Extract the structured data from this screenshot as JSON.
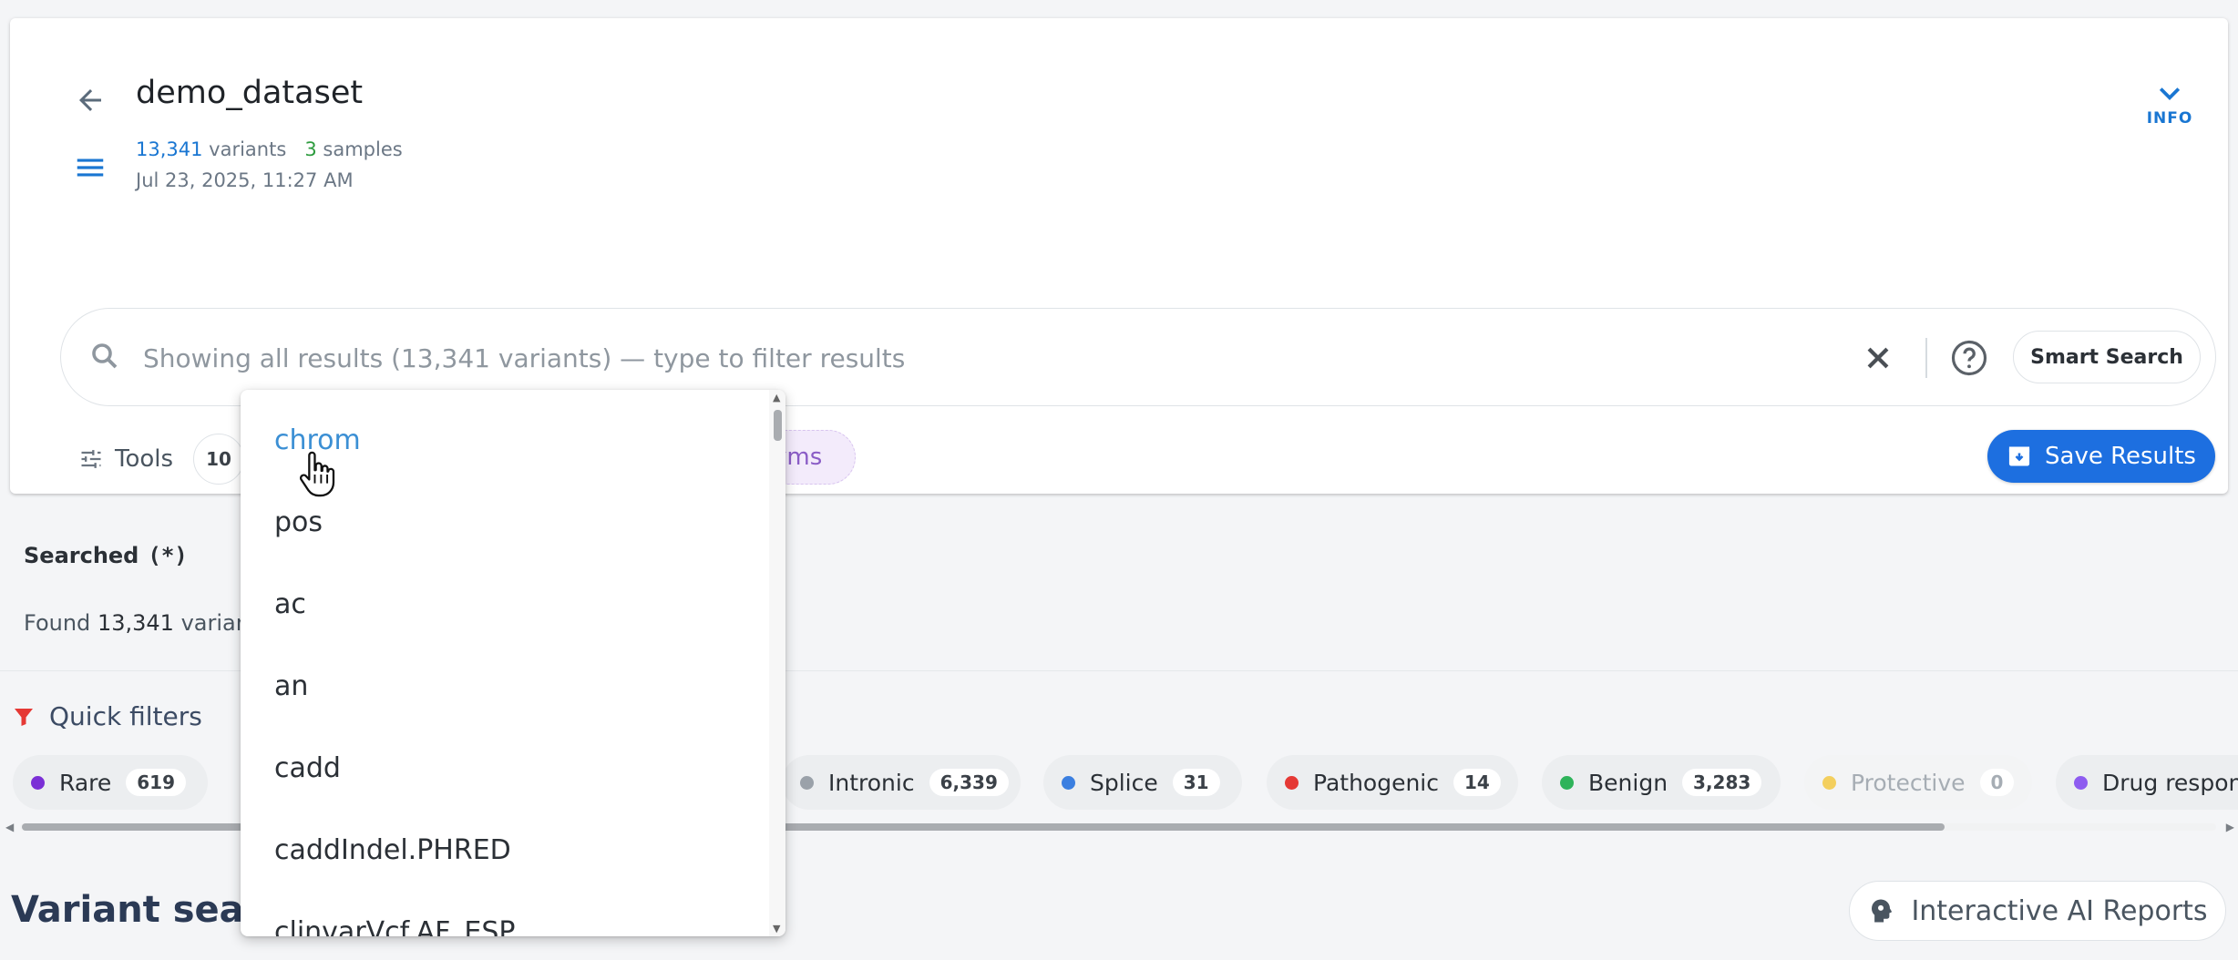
{
  "header": {
    "title": "demo_dataset",
    "variants_count": "13,341",
    "variants_label": "variants",
    "samples_count": "3",
    "samples_label": "samples",
    "date": "Jul 23, 2025, 11:27 AM",
    "info_label": "INFO"
  },
  "search": {
    "placeholder": "Showing all results (13,341 variants) — type to filter results",
    "value": "",
    "smart_search_label": "Smart Search"
  },
  "toolbar": {
    "tools_label": "Tools",
    "tools_count": "10",
    "synonyms_label_partial": "yms",
    "save_label": "Save Results"
  },
  "results": {
    "searched_label": "Searched",
    "searched_query": "(*)",
    "found_prefix": "Found",
    "found_count": "13,341",
    "found_suffix": "variant"
  },
  "quick_filters": {
    "title": "Quick filters",
    "chips": [
      {
        "label": "Rare",
        "count": "619",
        "color": "#7b2fd6",
        "disabled": false
      },
      {
        "label": "Intronic",
        "count": "6,339",
        "color": "#9aa1a9",
        "disabled": false
      },
      {
        "label": "Splice",
        "count": "31",
        "color": "#3b7fe0",
        "disabled": false
      },
      {
        "label": "Pathogenic",
        "count": "14",
        "color": "#e53935",
        "disabled": false
      },
      {
        "label": "Benign",
        "count": "3,283",
        "color": "#2eb35a",
        "disabled": false
      },
      {
        "label": "Protective",
        "count": "0",
        "color": "#f3cf5e",
        "disabled": true
      },
      {
        "label": "Drug respons",
        "count": "",
        "color": "#8e5cf0",
        "disabled": false
      }
    ]
  },
  "section": {
    "title": "Variant searc",
    "ai_reports_label": "Interactive AI Reports"
  },
  "dropdown": {
    "items": [
      "chrom",
      "pos",
      "ac",
      "an",
      "cadd",
      "caddIndel.PHRED",
      "clinvarVcf.AF_ESP"
    ],
    "active_index": 0
  },
  "colors": {
    "accent": "#1976d2",
    "save_button": "#1d6fe0",
    "synonyms_chip_bg": "#f3ebfb",
    "synonyms_chip_text": "#8a5cc6",
    "quick_filter_icon": "#e53935"
  },
  "icons": {
    "back": "arrow-left-icon",
    "menu": "hamburger-menu-icon",
    "info": "chevron-down-icon",
    "search": "search-icon",
    "clear": "close-icon",
    "help": "help-circle-icon",
    "tools": "sliders-icon",
    "save": "archive-box-icon",
    "quick_filters": "funnel-icon",
    "ai_reports": "brain-head-icon"
  }
}
